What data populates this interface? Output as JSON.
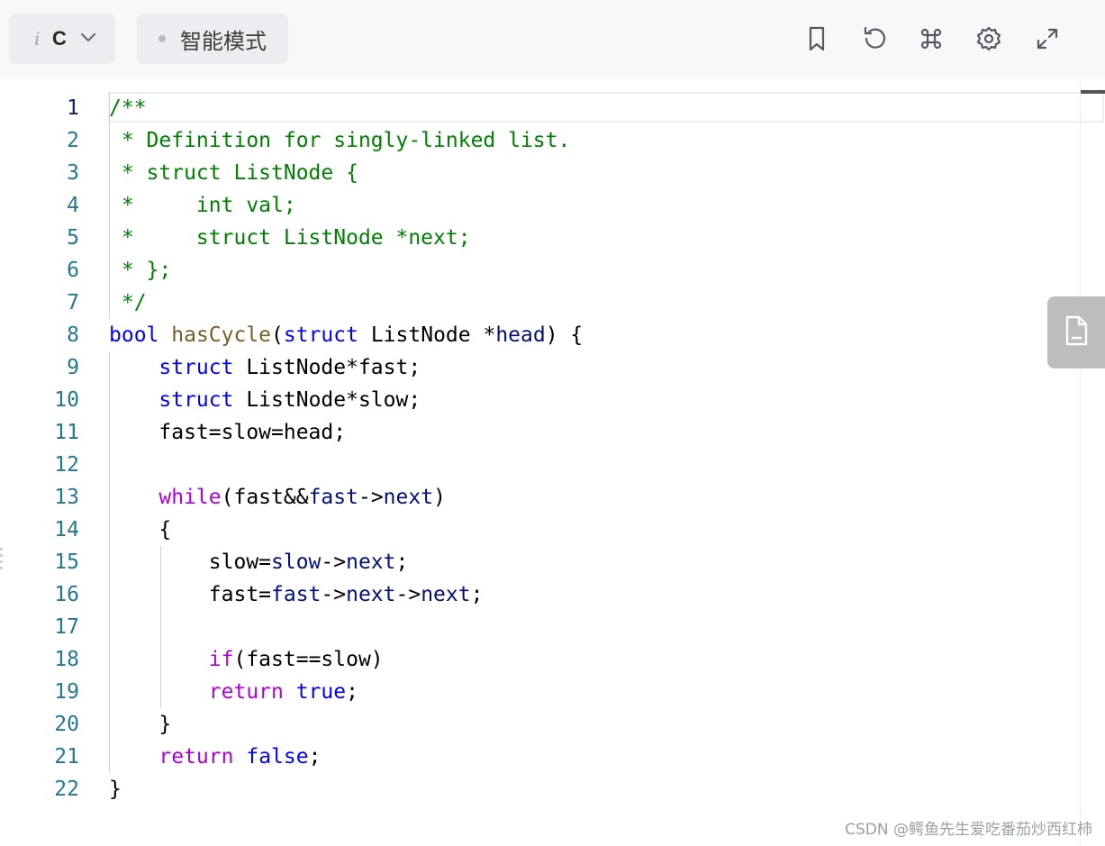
{
  "toolbar": {
    "language_icon": "i",
    "language": "C",
    "mode_label": "智能模式",
    "icons": [
      "bookmark-icon",
      "reset-icon",
      "command-icon",
      "settings-icon",
      "fullscreen-icon"
    ]
  },
  "editor": {
    "active_line": 1,
    "lines": [
      {
        "num": "1",
        "tokens": [
          {
            "t": "/**",
            "c": "comment"
          }
        ]
      },
      {
        "num": "2",
        "tokens": [
          {
            "t": " * Definition for singly-linked list.",
            "c": "comment"
          }
        ]
      },
      {
        "num": "3",
        "tokens": [
          {
            "t": " * struct ListNode {",
            "c": "comment"
          }
        ]
      },
      {
        "num": "4",
        "tokens": [
          {
            "t": " *     int val;",
            "c": "comment"
          }
        ]
      },
      {
        "num": "5",
        "tokens": [
          {
            "t": " *     struct ListNode *next;",
            "c": "comment"
          }
        ]
      },
      {
        "num": "6",
        "tokens": [
          {
            "t": " * };",
            "c": "comment"
          }
        ]
      },
      {
        "num": "7",
        "tokens": [
          {
            "t": " */",
            "c": "comment"
          }
        ]
      },
      {
        "num": "8",
        "tokens": [
          {
            "t": "bool",
            "c": "kw"
          },
          {
            "t": " ",
            "c": "type"
          },
          {
            "t": "hasCycle",
            "c": "fn"
          },
          {
            "t": "(",
            "c": "type"
          },
          {
            "t": "struct",
            "c": "kw"
          },
          {
            "t": " ListNode *",
            "c": "type"
          },
          {
            "t": "head",
            "c": "var"
          },
          {
            "t": ") {",
            "c": "type"
          }
        ]
      },
      {
        "num": "9",
        "tokens": [
          {
            "t": "    ",
            "c": "type"
          },
          {
            "t": "struct",
            "c": "kw"
          },
          {
            "t": " ListNode*fast;",
            "c": "type"
          }
        ]
      },
      {
        "num": "10",
        "tokens": [
          {
            "t": "    ",
            "c": "type"
          },
          {
            "t": "struct",
            "c": "kw"
          },
          {
            "t": " ListNode*slow;",
            "c": "type"
          }
        ]
      },
      {
        "num": "11",
        "tokens": [
          {
            "t": "    fast=slow=head;",
            "c": "type"
          }
        ]
      },
      {
        "num": "12",
        "tokens": []
      },
      {
        "num": "13",
        "tokens": [
          {
            "t": "    ",
            "c": "type"
          },
          {
            "t": "while",
            "c": "ctrl"
          },
          {
            "t": "(fast&&",
            "c": "type"
          },
          {
            "t": "fast",
            "c": "var"
          },
          {
            "t": "->",
            "c": "type"
          },
          {
            "t": "next",
            "c": "var"
          },
          {
            "t": ")",
            "c": "type"
          }
        ]
      },
      {
        "num": "14",
        "tokens": [
          {
            "t": "    {",
            "c": "type"
          }
        ]
      },
      {
        "num": "15",
        "tokens": [
          {
            "t": "        slow=",
            "c": "type"
          },
          {
            "t": "slow",
            "c": "var"
          },
          {
            "t": "->",
            "c": "type"
          },
          {
            "t": "next",
            "c": "var"
          },
          {
            "t": ";",
            "c": "type"
          }
        ]
      },
      {
        "num": "16",
        "tokens": [
          {
            "t": "        fast=",
            "c": "type"
          },
          {
            "t": "fast",
            "c": "var"
          },
          {
            "t": "->",
            "c": "type"
          },
          {
            "t": "next",
            "c": "var"
          },
          {
            "t": "->",
            "c": "type"
          },
          {
            "t": "next",
            "c": "var"
          },
          {
            "t": ";",
            "c": "type"
          }
        ]
      },
      {
        "num": "17",
        "tokens": []
      },
      {
        "num": "18",
        "tokens": [
          {
            "t": "        ",
            "c": "type"
          },
          {
            "t": "if",
            "c": "ctrl"
          },
          {
            "t": "(fast==slow)",
            "c": "type"
          }
        ]
      },
      {
        "num": "19",
        "tokens": [
          {
            "t": "        ",
            "c": "type"
          },
          {
            "t": "return",
            "c": "ctrl"
          },
          {
            "t": " ",
            "c": "type"
          },
          {
            "t": "true",
            "c": "kw"
          },
          {
            "t": ";",
            "c": "type"
          }
        ]
      },
      {
        "num": "20",
        "tokens": [
          {
            "t": "    }",
            "c": "type"
          }
        ]
      },
      {
        "num": "21",
        "tokens": [
          {
            "t": "    ",
            "c": "type"
          },
          {
            "t": "return",
            "c": "ctrl"
          },
          {
            "t": " ",
            "c": "type"
          },
          {
            "t": "false",
            "c": "kw"
          },
          {
            "t": ";",
            "c": "type"
          }
        ]
      },
      {
        "num": "22",
        "tokens": [
          {
            "t": "}",
            "c": "type"
          }
        ]
      }
    ]
  },
  "side_panel": {
    "icon": "file-icon"
  },
  "watermark": "CSDN @鳄鱼先生爱吃番茄炒西红柿",
  "colors": {
    "comment": "#008000",
    "keyword": "#0000ff",
    "control": "#af00db",
    "function": "#795e26",
    "variable": "#001080",
    "line_number": "#237893"
  }
}
